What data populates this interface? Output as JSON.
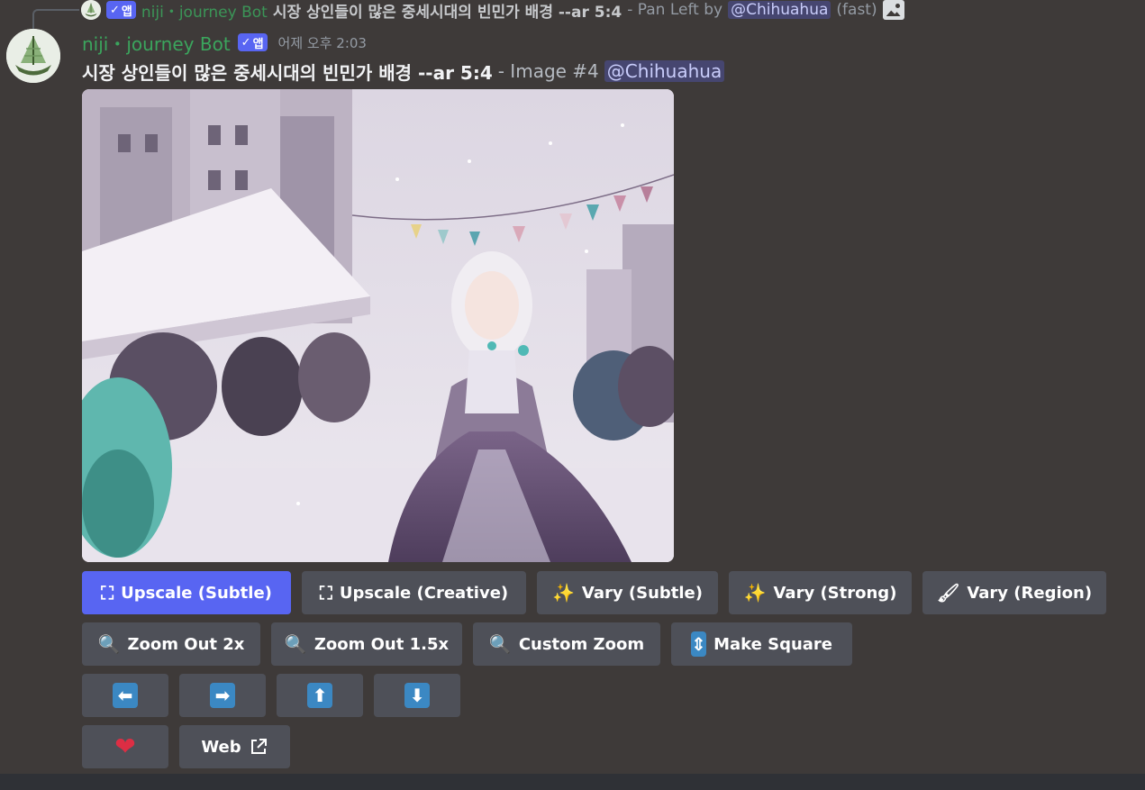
{
  "reply": {
    "bot_name": "niji・journey Bot",
    "app_badge": "앱",
    "prompt": "시장 상인들이 많은 중세시대의 빈민가 배경 --ar 5:4",
    "action_text": "- Pan Left by",
    "mention": "@Chihuahua",
    "suffix": "(fast)"
  },
  "message": {
    "bot_name": "niji・journey Bot",
    "app_badge": "앱",
    "timestamp": "어제 오후 2:03",
    "prompt": "시장 상인들이 많은 중세시대의 빈민가 배경 --ar 5:4",
    "image_label": "- Image #4",
    "mention": "@Chihuahua"
  },
  "buttons": {
    "upscale_subtle": "Upscale (Subtle)",
    "upscale_creative": "Upscale (Creative)",
    "vary_subtle": "Vary (Subtle)",
    "vary_strong": "Vary (Strong)",
    "vary_region": "Vary (Region)",
    "zoom_out_2x": "Zoom Out 2x",
    "zoom_out_1_5x": "Zoom Out 1.5x",
    "custom_zoom": "Custom Zoom",
    "make_square": "Make Square",
    "web": "Web"
  },
  "colors": {
    "background": "#3e3a39",
    "primary_button": "#5865f2",
    "secondary_button": "#4e5058",
    "bot_name": "#3ba55d",
    "arrow_icon": "#3b88c3",
    "heart": "#dd2e44"
  },
  "icons": {
    "upscale": "expand-arrows-icon",
    "vary": "magic-wand-icon",
    "region": "paintbrush-icon",
    "zoom": "magnifier-icon",
    "square": "up-down-arrow-icon",
    "pan": [
      "left-arrow-icon",
      "right-arrow-icon",
      "up-arrow-icon",
      "down-arrow-icon"
    ],
    "like": "heart-icon",
    "web": "external-link-icon"
  }
}
